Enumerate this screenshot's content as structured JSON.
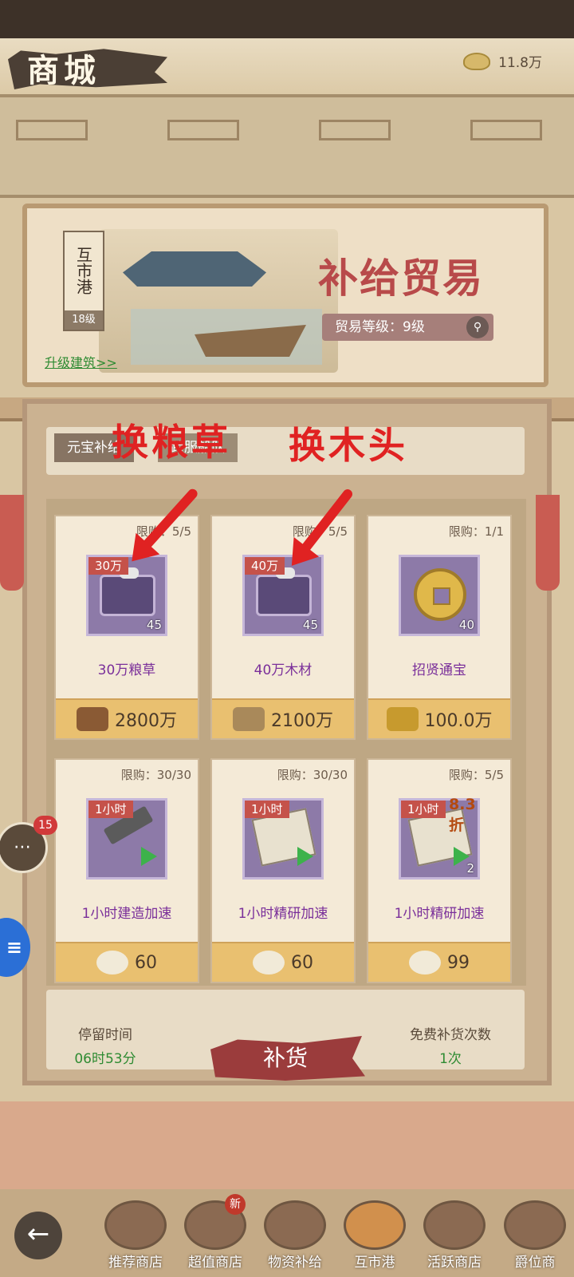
{
  "header": {
    "title": "商城",
    "currency_value": "11.8万"
  },
  "building": {
    "name": "互市港",
    "level": "18级",
    "upgrade_link": "升级建筑>>",
    "banner_title": "补给贸易",
    "trade_level": "贸易等级：9级"
  },
  "tabs": [
    "元宝补给",
    "跨服船队"
  ],
  "annotations": {
    "left": "换粮草",
    "right": "换木头"
  },
  "items": [
    {
      "limit": "限购：5/5",
      "tag": "30万",
      "qty": "45",
      "name": "30万粮草",
      "price": "2800万",
      "price_icon": "wood-logs-icon",
      "item_icon": "treasure-chest-icon"
    },
    {
      "limit": "限购：5/5",
      "tag": "40万",
      "qty": "45",
      "name": "40万木材",
      "price": "2100万",
      "price_icon": "grain-sacks-icon",
      "item_icon": "treasure-chest-icon"
    },
    {
      "limit": "限购：1/1",
      "tag": "",
      "qty": "40",
      "name": "招贤通宝",
      "price": "100.0万",
      "price_icon": "gold-bars-icon",
      "item_icon": "coin-icon"
    },
    {
      "limit": "限购：30/30",
      "tag": "1小时",
      "qty": "",
      "name": "1小时建造加速",
      "price": "60",
      "price_icon": "ingot-icon",
      "item_icon": "hammer-icon"
    },
    {
      "limit": "限购：30/30",
      "tag": "1小时",
      "qty": "",
      "name": "1小时精研加速",
      "price": "60",
      "price_icon": "ingot-icon",
      "item_icon": "scroll-icon"
    },
    {
      "limit": "限购：5/5",
      "tag": "1小时",
      "discount": "8.3折",
      "qty": "2",
      "name": "1小时精研加速",
      "price": "99",
      "price_icon": "ingot-icon",
      "item_icon": "scroll-icon"
    }
  ],
  "footer": {
    "stay_label": "停留时间",
    "stay_time": "06时53分",
    "restock": "补货",
    "free_label": "免费补货次数",
    "free_count": "1次"
  },
  "chat": {
    "badge": "15"
  },
  "nav": {
    "new_badge": "新",
    "items": [
      "推荐商店",
      "超值商店",
      "物资补给",
      "互市港",
      "活跃商店",
      "爵位商"
    ]
  },
  "colors": {
    "accent_red": "#b84a4a",
    "link_green": "#2e8b32",
    "item_purple": "#7a2f9a",
    "price_gold": "#e9c070",
    "annotation_red": "#e02222"
  }
}
